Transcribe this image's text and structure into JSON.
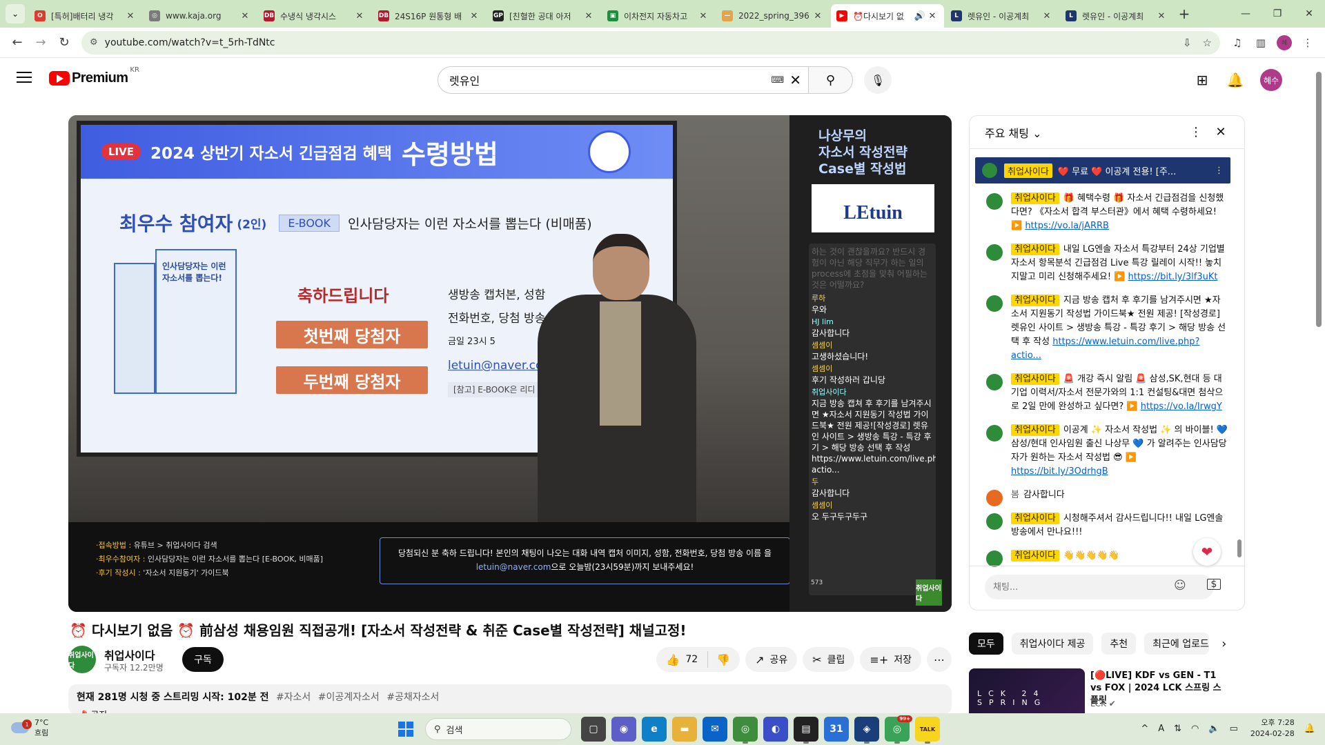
{
  "browser": {
    "tabs": [
      {
        "title": "[특허]배터리 냉각",
        "fav_color": "#e03a2e",
        "fav_text": "O",
        "active": false
      },
      {
        "title": "www.kaja.org",
        "fav_color": "#7a7a7a",
        "fav_text": "◎",
        "active": false
      },
      {
        "title": "수냉식 냉각시스",
        "fav_color": "#b5172b",
        "fav_text": "DB",
        "active": false
      },
      {
        "title": "24S16P 원통형 배",
        "fav_color": "#b5172b",
        "fav_text": "DB",
        "active": false
      },
      {
        "title": "[친혈한 공대 아저",
        "fav_color": "#222222",
        "fav_text": "GP",
        "active": false
      },
      {
        "title": "이차전지 자동차고",
        "fav_color": "#1e8e3e",
        "fav_text": "▣",
        "active": false
      },
      {
        "title": "2022_spring_396",
        "fav_color": "#e5a44a",
        "fav_text": "—",
        "active": false
      },
      {
        "title": "⏰다시보기 없",
        "fav_color": "#ff0000",
        "fav_text": "▶",
        "active": true
      },
      {
        "title": "렛유인 - 이공계최",
        "fav_color": "#1d3670",
        "fav_text": "L",
        "active": false
      },
      {
        "title": "렛유인 - 이공계최",
        "fav_color": "#1d3670",
        "fav_text": "L",
        "active": false
      }
    ],
    "url": "youtube.com/watch?v=t_5rh-TdNtc",
    "profile_initial": "혜"
  },
  "youtube": {
    "logo_text": "Premium",
    "logo_region": "KR",
    "search_value": "렛유인",
    "avatar_text": "혜수"
  },
  "player": {
    "slide": {
      "live_label": "LIVE",
      "banner_text": "2024 상반기 자소서 긴급점검 혜택",
      "banner_big": "수령방법",
      "award_title": "최우수 참여자",
      "award_sub": "(2인)",
      "ebook_tag": "E-BOOK",
      "award_desc": "인사담당자는 이런 자소서를 뽑는다 (비매품)",
      "book_title": "인사담당자는 이런 자소서를 뽑는다!",
      "congrats": "축하드립니다",
      "winner1": "첫번째 당첨자",
      "winner2": "두번째 당첨자",
      "instr1": "생방송 캡처본, 성함",
      "instr2": "전화번호, 당첨 방송 이",
      "instr3": "금일 23시 5",
      "email": "letuin@naver.com",
      "ref": "[참고] E-BOOK은 리디"
    },
    "info_left": [
      {
        "k": "·접속방법 :",
        "v": "유튜브 > 취업사이다 검색"
      },
      {
        "k": "·최우수참여자 :",
        "v": "인사담당자는 이런 자소서를 뽑는다 [E-BOOK, 비매품]"
      },
      {
        "k": "·후기 작성시 :",
        "v": "'자소서 지원동기' 가이드북"
      }
    ],
    "info_box_line1": "당첨되신 분 축하 드립니다! 본인의 채팅이 나오는 대화 내역 캡처 이미지, 성함, 전화번호, 당첨 방송 이름 을",
    "info_box_email": "letuin@naver.com",
    "info_box_line2": "으로 오늘밤(23시59분)까지 보내주세요!",
    "side_title": "나상무의\n자소서 작성전략\nCase별 작성법",
    "side_logo": "LEtuin",
    "side_pre": "하는 것이 괜찮을까요? 반드시 경험이 아닌 해당 직무가 하는 일의 process에 초점을 맞춰 어필하는 것은 어떨까요?",
    "side_chat": [
      {
        "name": "루하",
        "text": "우와"
      },
      {
        "name": "HJ lim",
        "text": "감사합니다"
      },
      {
        "name": "셈셈이",
        "text": "고생하셨습니다!"
      },
      {
        "name": "셈셈이",
        "text": "후기 작성하러 갑니당"
      },
      {
        "name": "취업사이다",
        "text": "지금 방송 캡쳐 후 후기를 남겨주시면 ★자소서 지원동기 작성법 가이드북★ 전원 제공![작성경로] 렛유인 사이트 > 생방송 특강 - 특강 후기 > 해당 방송 선택 후 작성 https://www.letuin.com/live.php?actio..."
      },
      {
        "name": "두",
        "text": "감사합니다"
      },
      {
        "name": "셈셈이",
        "text": "오 두구두구두구"
      }
    ],
    "side_count": "573",
    "side_badge": "취업사이다"
  },
  "video": {
    "title": "⏰ 다시보기 없음 ⏰  前삼성 채용임원 직접공개! [자소서 작성전략 & 취준 Case별 작성전략] 채널고정!",
    "channel_name": "취업사이다",
    "channel_subs": "구독자 12.2만명",
    "avatar_text": "취업사이다",
    "subscribe": "구독",
    "likes": "72",
    "share": "공유",
    "clip": "클립",
    "save": "저장",
    "desc_stat": "현재 281명 시청 중 스트리밍 시작: 102분 전",
    "desc_tags": [
      "#자소서",
      "#이공계자소서",
      "#공채자소서"
    ],
    "desc_notice": "📌 공지"
  },
  "chat": {
    "title": "주요 채팅",
    "pinned_author": "취업사이다",
    "pinned_text": "❤️ 무료 ❤️ 이공계 전용! [주...",
    "messages": [
      {
        "author": "취업사이다",
        "text": "🎁 혜택수령 🎁 자소서 긴급점검을 신청했다면? 《자소서 합격 부스터관》에서 혜택 수령하세요! ▶️ ",
        "link": "https://vo.la/jARRB"
      },
      {
        "author": "취업사이다",
        "text": "내일 LG엔솔 자소서 특강부터 24상 기업별 자소서 항목분석 긴급점검 Live 특강 릴레이 시작!! 놓치지말고 미리 신청해주세요! ▶️ ",
        "link": "https://bit.ly/3lf3uKt"
      },
      {
        "author": "취업사이다",
        "text": "지금 방송 캡처 후 후기를 남겨주시면 ★자소서 지원동기 작성법 가이드북★ 전원 제공! [작성경로] 렛유인 사이트 > 생방송 특강 - 특강 후기 > 해당 방송 선택 후 작성 ",
        "link": "https://www.letuin.com/live.php?actio..."
      },
      {
        "author": "취업사이다",
        "text": "🚨 개강 즉시 알림 🚨 삼성,SK,현대 등 대기업 이력서/자소서 전문가와의 1:1 컨설팅&대면 첨삭으로 2일 만에 완성하고 싶다면? ▶️ ",
        "link": "https://vo.la/IrwgY"
      },
      {
        "author": "취업사이다",
        "text": "이공계 ✨ 자소서 작성법 ✨ 의 바이블! 💙 삼성/현대 인사임원 출신 나상무 💙 가 알려주는 인사담당자가 원하는 자소서 작성법 😎 ▶️ ",
        "link": "https://bit.ly/3OdrhgB"
      },
      {
        "author": "봄",
        "plain": true,
        "text": "감사합니다",
        "link": ""
      },
      {
        "author": "취업사이다",
        "text": "시청해주셔서 감사드립니다!! 내일 LG엔솔 방송에서 만나요!!!",
        "link": ""
      },
      {
        "author": "취업사이다",
        "text": "👋👋👋👋👋",
        "link": ""
      }
    ],
    "input_placeholder": "채팅..."
  },
  "recommendations": {
    "chips": [
      "모두",
      "취업사이다 제공",
      "추천",
      "최근에 업로드"
    ],
    "item": {
      "title_red": "🔴",
      "title": "LIVE] KDF vs GEN - T1 vs FOX | 2024 LCK 스프링 스플릿",
      "title_prefix": "[",
      "channel": "LCK ✔",
      "thumb_text": "LCK 24 SPRING"
    }
  },
  "taskbar": {
    "temp": "7°C",
    "weather": "흐림",
    "weather_badge": "1",
    "search_label": "검색",
    "time": "오후 7:28",
    "date": "2024-02-28",
    "app_badge": "99+",
    "apps": [
      {
        "name": "task-view",
        "color": "#444444",
        "glyph": "▢"
      },
      {
        "name": "teams-chat",
        "color": "#5b5fc7",
        "glyph": "◉"
      },
      {
        "name": "edge",
        "color": "#0f7fc7",
        "glyph": "e"
      },
      {
        "name": "file-explorer",
        "color": "#e8b23a",
        "glyph": "▬"
      },
      {
        "name": "mail",
        "color": "#0a64c8",
        "glyph": "✉"
      },
      {
        "name": "chrome",
        "color": "#3d8d3d",
        "glyph": "◎"
      },
      {
        "name": "chrome-alt",
        "color": "#3a4fc7",
        "glyph": "◐"
      },
      {
        "name": "sticky-notes",
        "color": "#222222",
        "glyph": "▤"
      },
      {
        "name": "calendar",
        "color": "#2a6fd6",
        "glyph": "31"
      },
      {
        "name": "teams",
        "color": "#1a3e7a",
        "glyph": "◈"
      },
      {
        "name": "chrome-profile",
        "color": "#3aa357",
        "glyph": "◎"
      },
      {
        "name": "kakaotalk",
        "color": "#f7d41e",
        "glyph": "TALK"
      }
    ]
  }
}
